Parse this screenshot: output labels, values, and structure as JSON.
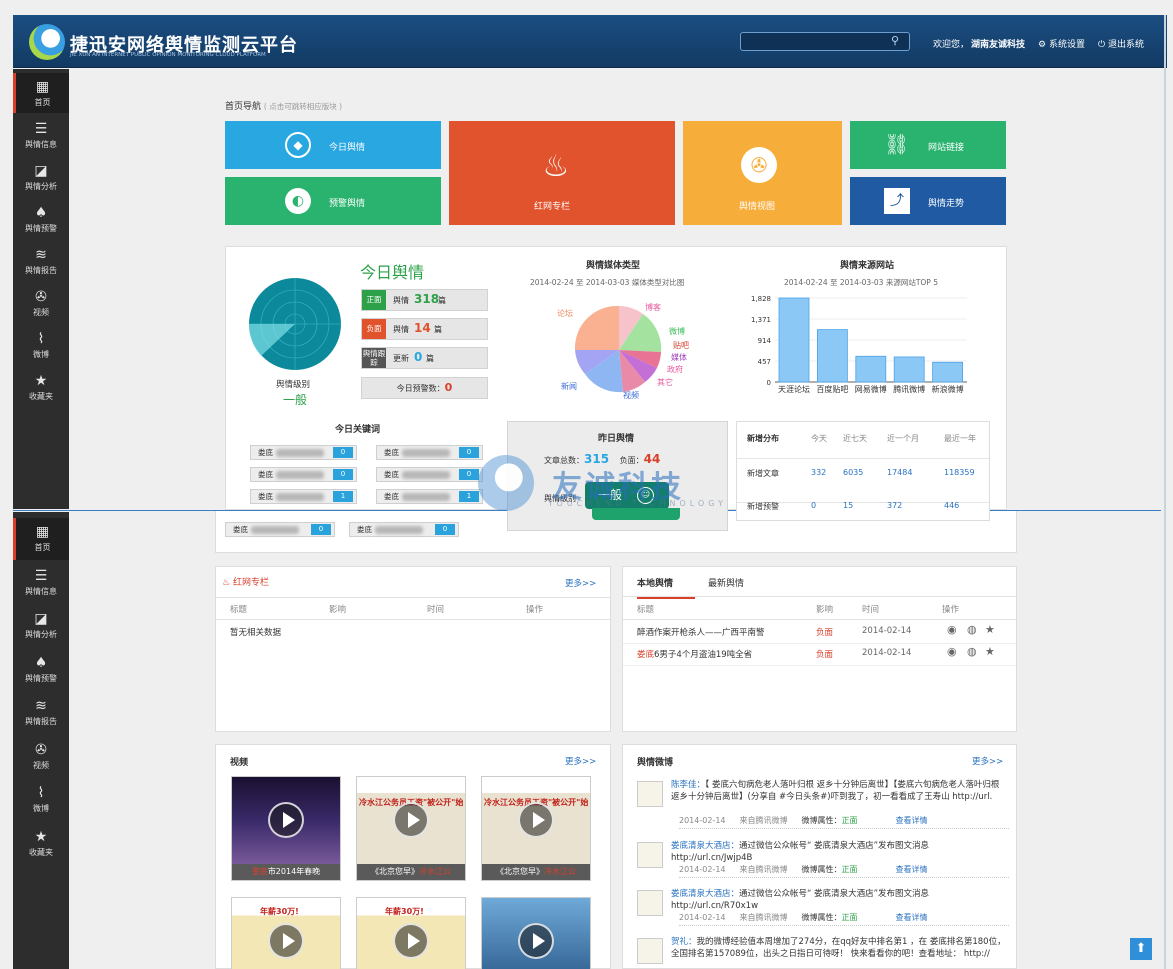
{
  "header": {
    "title": "捷迅安网络舆情监测云平台",
    "subtitle": "JIE XUN AN INTERNET PUBLIC OPINION MONITORING CLOUD PLATFORM",
    "welcome": "欢迎您，",
    "user": "湖南友诚科技",
    "settings": "系统设置",
    "logout": "退出系统",
    "search_placeholder": ""
  },
  "sidebar": [
    {
      "label": "首页",
      "icon": "grid-icon"
    },
    {
      "label": "舆情信息",
      "icon": "list-icon"
    },
    {
      "label": "舆情分析",
      "icon": "chart-icon"
    },
    {
      "label": "舆情预警",
      "icon": "bell-icon"
    },
    {
      "label": "舆情报告",
      "icon": "layers-icon"
    },
    {
      "label": "视频",
      "icon": "film-icon"
    },
    {
      "label": "微博",
      "icon": "rss-icon"
    },
    {
      "label": "收藏夹",
      "icon": "star-icon"
    }
  ],
  "nav": {
    "title": "首页导航",
    "hint": "( 点击可跳转相应版块 )",
    "tiles": {
      "today": "今日舆情",
      "warning": "预警舆情",
      "hotnet": "红网专栏",
      "video": "舆情视图",
      "links": "网站链接",
      "trend": "舆情走势"
    }
  },
  "today": {
    "title": "今日舆情",
    "level_label": "舆情级别",
    "level": "一般",
    "stats": [
      {
        "tag": "正面",
        "label": "舆情",
        "value": "318",
        "unit": "篇"
      },
      {
        "tag": "负面",
        "label": "舆情",
        "value": "14",
        "unit": "篇"
      },
      {
        "tag": "舆情跟踪",
        "label": "更新",
        "value": "0",
        "unit": "篇"
      }
    ],
    "warn_label": "今日预警数：",
    "warn_value": "0"
  },
  "keywords": {
    "title": "今日关键词",
    "items": [
      {
        "word": "娄底",
        "count": "0"
      },
      {
        "word": "娄底",
        "count": "0"
      },
      {
        "word": "娄底",
        "count": "0"
      },
      {
        "word": "娄底",
        "count": "0"
      },
      {
        "word": "娄底",
        "count": "1"
      },
      {
        "word": "娄底",
        "count": "1"
      },
      {
        "word": "娄底",
        "count": "0"
      },
      {
        "word": "娄底",
        "count": "0"
      }
    ]
  },
  "media": {
    "title": "舆情媒体类型",
    "subtitle": "2014-02-24 至 2014-03-03 媒体类型对比图",
    "labels": [
      "论坛",
      "博客",
      "微博",
      "贴吧",
      "媒体",
      "政府",
      "其它",
      "视频",
      "新闻"
    ]
  },
  "yesterday": {
    "title": "昨日舆情",
    "total_label": "文章总数：",
    "total": "315",
    "neg_label": "负面：",
    "neg": "44",
    "level_label": "舆情级别",
    "level": "一般"
  },
  "watermark": {
    "cn": "友诚科技",
    "en": "YOUCHENG TECHNOLOGY"
  },
  "newstats": {
    "headers": [
      "新增分布",
      "今天",
      "近七天",
      "近一个月",
      "最近一年"
    ],
    "rows": [
      {
        "label": "新增文章",
        "values": [
          "332",
          "6035",
          "17484",
          "118359"
        ]
      },
      {
        "label": "新增预警",
        "values": [
          "0",
          "15",
          "372",
          "446"
        ]
      }
    ]
  },
  "hotnet": {
    "title": "红网专栏",
    "more": "更多>>",
    "headers": [
      "标题",
      "影响",
      "时间",
      "操作"
    ],
    "empty": "暂无相关数据"
  },
  "local": {
    "tabs": [
      "本地舆情",
      "最新舆情"
    ],
    "headers": [
      "标题",
      "影响",
      "时间",
      "操作"
    ],
    "rows": [
      {
        "title": "醉酒作案开枪杀人——广西平南警",
        "impact": "负面",
        "date": "2014-02-14"
      },
      {
        "title_hl": "娄底",
        "title": "6男子4个月盗油19吨全省",
        "impact": "负面",
        "date": "2014-02-14"
      }
    ]
  },
  "video": {
    "title": "视频",
    "more": "更多>>",
    "items": [
      {
        "cap_hl": "娄底",
        "cap": "市2014年春晚"
      },
      {
        "cap": "《北京您早》",
        "cap_hl": "冷水江公"
      },
      {
        "cap": "《北京您早》",
        "cap_hl": "冷水江公"
      }
    ],
    "row2": [
      "",
      "",
      ""
    ],
    "banner": "冷水江公务员工资\"被公开\"始末",
    "tag2": "年薪30万!"
  },
  "weibo": {
    "title": "舆情微博",
    "more": "更多>>",
    "items": [
      {
        "name": "陈李佳：",
        "text": "【 娄底六旬病危老人落叶归根 返乡十分钟后离世】【娄底六旬病危老人落叶归根 返乡十分钟后离世】(分享自 #今日头条#)吓到我了，初一看看成了王寿山 http://url.",
        "date": "2014-02-14",
        "source": "来自腾讯微博",
        "attr_label": "微博属性：",
        "attr": "正面",
        "detail": "查看详情"
      },
      {
        "name": "娄底清泉大酒店：",
        "text": "通过微信公众帐号“ 娄底清泉大酒店”发布图文消息 http://url.cn/Jwjp4B",
        "date": "2014-02-14",
        "source": "来自腾讯微博",
        "attr_label": "微博属性：",
        "attr": "正面",
        "detail": "查看详情"
      },
      {
        "name": "娄底清泉大酒店：",
        "text": "通过微信公众帐号“ 娄底清泉大酒店”发布图文消息 http://url.cn/R70x1w",
        "date": "2014-02-14",
        "source": "来自腾讯微博",
        "attr_label": "微博属性：",
        "attr": "正面",
        "detail": "查看详情"
      },
      {
        "name": "贺礼：",
        "text": "我的微博经验值本周增加了274分，在qq好友中排名第1 ，在 娄底排名第180位，全国排名第157089位，出头之日指日可待呀！ 快来看看你的吧！查看地址： http://",
        "date": "",
        "source": "",
        "attr_label": "",
        "attr": "",
        "detail": ""
      }
    ]
  },
  "colors": {
    "blue": "#29a7e1",
    "green": "#29b36e",
    "red": "#e0532c",
    "orange": "#f7ad3a",
    "navy": "#1f5aa3"
  }
}
